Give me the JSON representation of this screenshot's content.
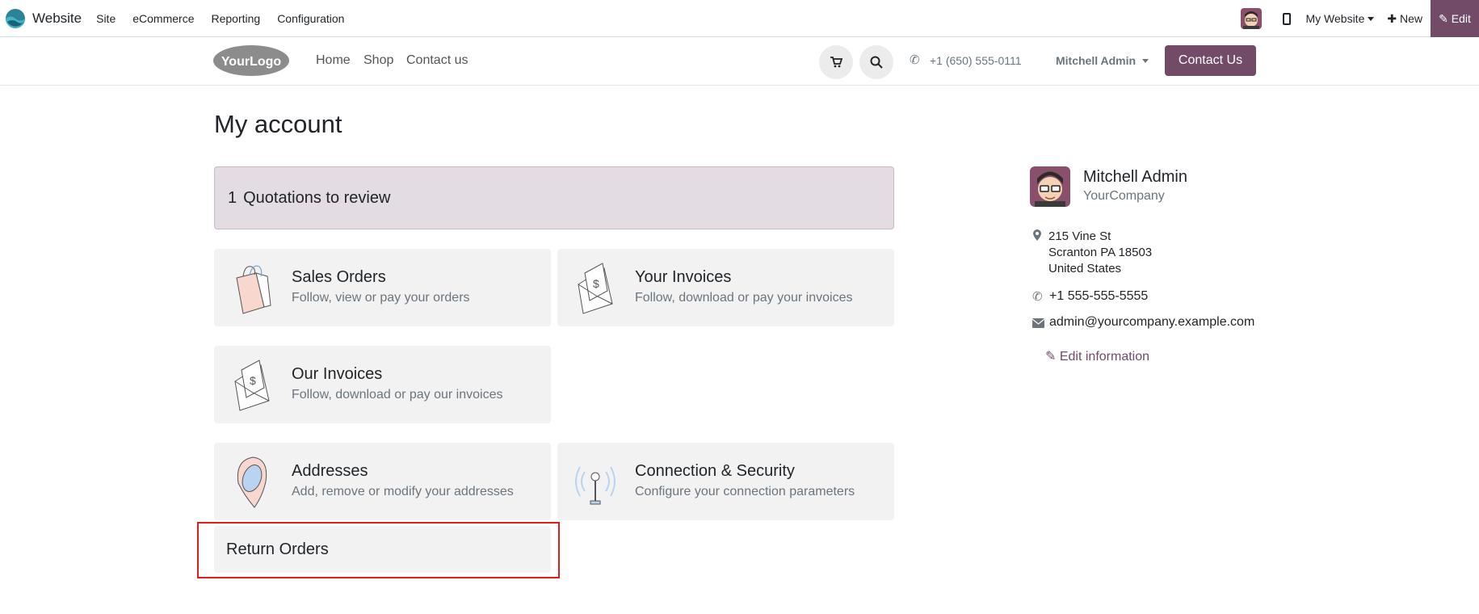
{
  "topbar": {
    "app_name": "Website",
    "menus": [
      "Site",
      "eCommerce",
      "Reporting",
      "Configuration"
    ],
    "site_selector": "My Website",
    "new_label": "New",
    "edit_label": "Edit"
  },
  "header": {
    "nav": [
      "Home",
      "Shop",
      "Contact us"
    ],
    "phone": "+1 (650) 555-0111",
    "user": "Mitchell Admin",
    "contact_button": "Contact Us",
    "logo_text": "YourLogo"
  },
  "main": {
    "title": "My account",
    "quotations_count": "1",
    "quotations_label": "Quotations to review",
    "cards": [
      {
        "title": "Sales Orders",
        "subtitle": "Follow, view or pay your orders",
        "icon": "shopping-bag-icon"
      },
      {
        "title": "Your Invoices",
        "subtitle": "Follow, download or pay your invoices",
        "icon": "invoice-envelope-icon"
      },
      {
        "title": "Our Invoices",
        "subtitle": "Follow, download or pay our invoices",
        "icon": "invoice-envelope-icon"
      },
      {
        "title": "Addresses",
        "subtitle": "Add, remove or modify your addresses",
        "icon": "map-pin-icon"
      },
      {
        "title": "Connection & Security",
        "subtitle": "Configure your connection parameters",
        "icon": "antenna-icon"
      }
    ],
    "return_orders": "Return Orders"
  },
  "sidebar": {
    "name": "Mitchell Admin",
    "company": "YourCompany",
    "address": [
      "215 Vine St",
      "Scranton PA 18503",
      "United States"
    ],
    "phone": "+1 555-555-5555",
    "email": "admin@yourcompany.example.com",
    "edit_label": "Edit information"
  },
  "colors": {
    "brand": "#714b67",
    "highlight": "#e11d1d",
    "card_bg": "#f2f2f2",
    "alert_bg": "#e3dde3"
  }
}
